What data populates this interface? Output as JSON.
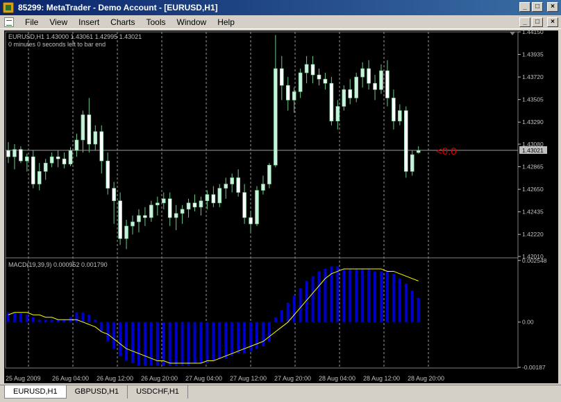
{
  "window": {
    "title": "85299: MetaTrader - Demo Account - [EURUSD,H1]",
    "buttons": [
      "_",
      "□",
      "×"
    ]
  },
  "menu": {
    "items": [
      "File",
      "View",
      "Insert",
      "Charts",
      "Tools",
      "Window",
      "Help"
    ],
    "doc_buttons": [
      "_",
      "□",
      "×"
    ]
  },
  "chart": {
    "symbol_line": "EURUSD,H1  1.43000 1.43061 1.42995 1.43021",
    "timer_line": "0 minutes 0 seconds left to bar end",
    "current_price": "1.43021",
    "spread_label": "<0.0",
    "price_ticks": [
      "1.44150",
      "1.43935",
      "1.43720",
      "1.43505",
      "1.43290",
      "1.43080",
      "1.42865",
      "1.42650",
      "1.42435",
      "1.42220",
      "1.42010"
    ],
    "macd_label": "MACD(19,39,9) 0.000952 0.001790",
    "macd_ticks": [
      "0.002548",
      "0.00",
      "-0.00187"
    ],
    "time_ticks": [
      "25 Aug 2009",
      "26 Aug 04:00",
      "26 Aug 12:00",
      "26 Aug 20:00",
      "27 Aug 04:00",
      "27 Aug 12:00",
      "27 Aug 20:00",
      "28 Aug 04:00",
      "28 Aug 12:00",
      "28 Aug 20:00"
    ],
    "colors": {
      "bull": "#c8f0dc",
      "bear": "#ffffff",
      "wick": "#6ec88c",
      "macd_bar": "#0000cd",
      "signal": "#ffff00",
      "grid": "#9a9a9a",
      "spread": "#e00000"
    }
  },
  "chart_data": {
    "type": "candlestick",
    "ylim": [
      1.4201,
      1.4415
    ],
    "candles": [
      [
        1.4302,
        1.431,
        1.429,
        1.4296
      ],
      [
        1.4296,
        1.4308,
        1.4284,
        1.4303
      ],
      [
        1.4303,
        1.4306,
        1.429,
        1.4292
      ],
      [
        1.4292,
        1.4299,
        1.4282,
        1.4296
      ],
      [
        1.4296,
        1.4302,
        1.4266,
        1.427
      ],
      [
        1.427,
        1.429,
        1.4264,
        1.4282
      ],
      [
        1.4282,
        1.4294,
        1.4274,
        1.429
      ],
      [
        1.429,
        1.43,
        1.4286,
        1.4296
      ],
      [
        1.4296,
        1.4302,
        1.4286,
        1.4294
      ],
      [
        1.4294,
        1.43,
        1.4285,
        1.4289
      ],
      [
        1.4289,
        1.4305,
        1.4287,
        1.4302
      ],
      [
        1.4302,
        1.4318,
        1.4296,
        1.4312
      ],
      [
        1.4312,
        1.434,
        1.43,
        1.4336
      ],
      [
        1.4336,
        1.4352,
        1.43,
        1.4308
      ],
      [
        1.4308,
        1.4326,
        1.4302,
        1.432
      ],
      [
        1.432,
        1.4326,
        1.428,
        1.4292
      ],
      [
        1.4292,
        1.43,
        1.426,
        1.4266
      ],
      [
        1.4266,
        1.4272,
        1.4232,
        1.4254
      ],
      [
        1.4254,
        1.4262,
        1.4212,
        1.4218
      ],
      [
        1.4218,
        1.4236,
        1.4208,
        1.423
      ],
      [
        1.423,
        1.424,
        1.4222,
        1.4234
      ],
      [
        1.4234,
        1.4246,
        1.4224,
        1.424
      ],
      [
        1.424,
        1.4248,
        1.423,
        1.4238
      ],
      [
        1.4238,
        1.4254,
        1.4234,
        1.425
      ],
      [
        1.425,
        1.4258,
        1.424,
        1.4252
      ],
      [
        1.4252,
        1.4262,
        1.4246,
        1.4256
      ],
      [
        1.4256,
        1.4262,
        1.423,
        1.4238
      ],
      [
        1.4238,
        1.425,
        1.4226,
        1.4242
      ],
      [
        1.4242,
        1.425,
        1.4232,
        1.4246
      ],
      [
        1.4246,
        1.4256,
        1.4238,
        1.4252
      ],
      [
        1.4252,
        1.426,
        1.4244,
        1.4248
      ],
      [
        1.4248,
        1.4258,
        1.424,
        1.4254
      ],
      [
        1.4254,
        1.4264,
        1.4246,
        1.426
      ],
      [
        1.426,
        1.4268,
        1.4248,
        1.4252
      ],
      [
        1.4252,
        1.427,
        1.4248,
        1.4266
      ],
      [
        1.4266,
        1.4276,
        1.4256,
        1.427
      ],
      [
        1.427,
        1.428,
        1.4262,
        1.4276
      ],
      [
        1.4276,
        1.4284,
        1.4258,
        1.4262
      ],
      [
        1.4262,
        1.427,
        1.4232,
        1.4238
      ],
      [
        1.4238,
        1.4244,
        1.4224,
        1.4232
      ],
      [
        1.4232,
        1.4268,
        1.423,
        1.4264
      ],
      [
        1.4264,
        1.4278,
        1.426,
        1.427
      ],
      [
        1.427,
        1.429,
        1.4266,
        1.4288
      ],
      [
        1.4288,
        1.4412,
        1.4286,
        1.438
      ],
      [
        1.438,
        1.4392,
        1.435,
        1.4364
      ],
      [
        1.4364,
        1.4372,
        1.434,
        1.435
      ],
      [
        1.435,
        1.4362,
        1.4338,
        1.4358
      ],
      [
        1.4358,
        1.438,
        1.4352,
        1.4376
      ],
      [
        1.4376,
        1.4392,
        1.4366,
        1.4384
      ],
      [
        1.4384,
        1.4392,
        1.4366,
        1.4374
      ],
      [
        1.4374,
        1.438,
        1.4364,
        1.437
      ],
      [
        1.437,
        1.4376,
        1.436,
        1.4366
      ],
      [
        1.4366,
        1.4372,
        1.4326,
        1.433
      ],
      [
        1.433,
        1.435,
        1.4322,
        1.4344
      ],
      [
        1.4344,
        1.4364,
        1.434,
        1.436
      ],
      [
        1.436,
        1.437,
        1.4346,
        1.4352
      ],
      [
        1.4352,
        1.4376,
        1.4348,
        1.4372
      ],
      [
        1.4372,
        1.4386,
        1.4362,
        1.438
      ],
      [
        1.438,
        1.4388,
        1.436,
        1.4366
      ],
      [
        1.4366,
        1.4374,
        1.435,
        1.436
      ],
      [
        1.436,
        1.4384,
        1.4356,
        1.4378
      ],
      [
        1.4378,
        1.4388,
        1.4344,
        1.4352
      ],
      [
        1.4352,
        1.436,
        1.4322,
        1.433
      ],
      [
        1.433,
        1.4346,
        1.4326,
        1.434
      ],
      [
        1.434,
        1.4344,
        1.4276,
        1.4282
      ],
      [
        1.4282,
        1.4302,
        1.4278,
        1.4298
      ],
      [
        1.43,
        1.4306,
        1.4299,
        1.4302
      ]
    ],
    "macd": [
      0.0004,
      0.0004,
      0.0004,
      0.0003,
      0.0002,
      0.0001,
      0.0001,
      0.0001,
      0.0001,
      0.0001,
      0.0002,
      0.0004,
      0.0004,
      0.0003,
      0.0001,
      -0.0004,
      -0.0008,
      -0.0011,
      -0.0014,
      -0.0016,
      -0.0017,
      -0.0018,
      -0.0018,
      -0.0018,
      -0.0018,
      -0.0018,
      -0.0018,
      -0.0018,
      -0.0018,
      -0.0018,
      -0.0017,
      -0.0017,
      -0.0017,
      -0.0016,
      -0.0015,
      -0.0015,
      -0.0014,
      -0.0013,
      -0.0013,
      -0.0012,
      -0.0011,
      -0.001,
      -0.0008,
      0.0002,
      0.0005,
      0.0008,
      0.0011,
      0.0014,
      0.0017,
      0.0019,
      0.0021,
      0.0022,
      0.0023,
      0.0023,
      0.0022,
      0.0022,
      0.0022,
      0.0022,
      0.0022,
      0.0021,
      0.0021,
      0.0021,
      0.002,
      0.0018,
      0.0016,
      0.0013,
      0.001
    ],
    "signal": [
      0.0003,
      0.0004,
      0.0004,
      0.0004,
      0.0003,
      0.0003,
      0.0002,
      0.0002,
      0.0001,
      0.0001,
      0.0001,
      0.0001,
      0.0,
      -0.0001,
      -0.0002,
      -0.0004,
      -0.0005,
      -0.0007,
      -0.0009,
      -0.0011,
      -0.0012,
      -0.0013,
      -0.0014,
      -0.0015,
      -0.0016,
      -0.0016,
      -0.0017,
      -0.0017,
      -0.0017,
      -0.0017,
      -0.0017,
      -0.0017,
      -0.0016,
      -0.0016,
      -0.0015,
      -0.0014,
      -0.0013,
      -0.0012,
      -0.0011,
      -0.001,
      -0.0009,
      -0.0008,
      -0.0006,
      -0.0004,
      -0.0002,
      0.0,
      0.0003,
      0.0006,
      0.0009,
      0.0012,
      0.0015,
      0.0018,
      0.002,
      0.0021,
      0.0022,
      0.0022,
      0.0022,
      0.0022,
      0.0022,
      0.0022,
      0.0022,
      0.0021,
      0.0021,
      0.002,
      0.0019,
      0.0018,
      0.0017
    ],
    "macd_ylim": [
      -0.0019,
      0.0026
    ]
  },
  "tabs": [
    "EURUSD,H1",
    "GBPUSD,H1",
    "USDCHF,H1"
  ]
}
